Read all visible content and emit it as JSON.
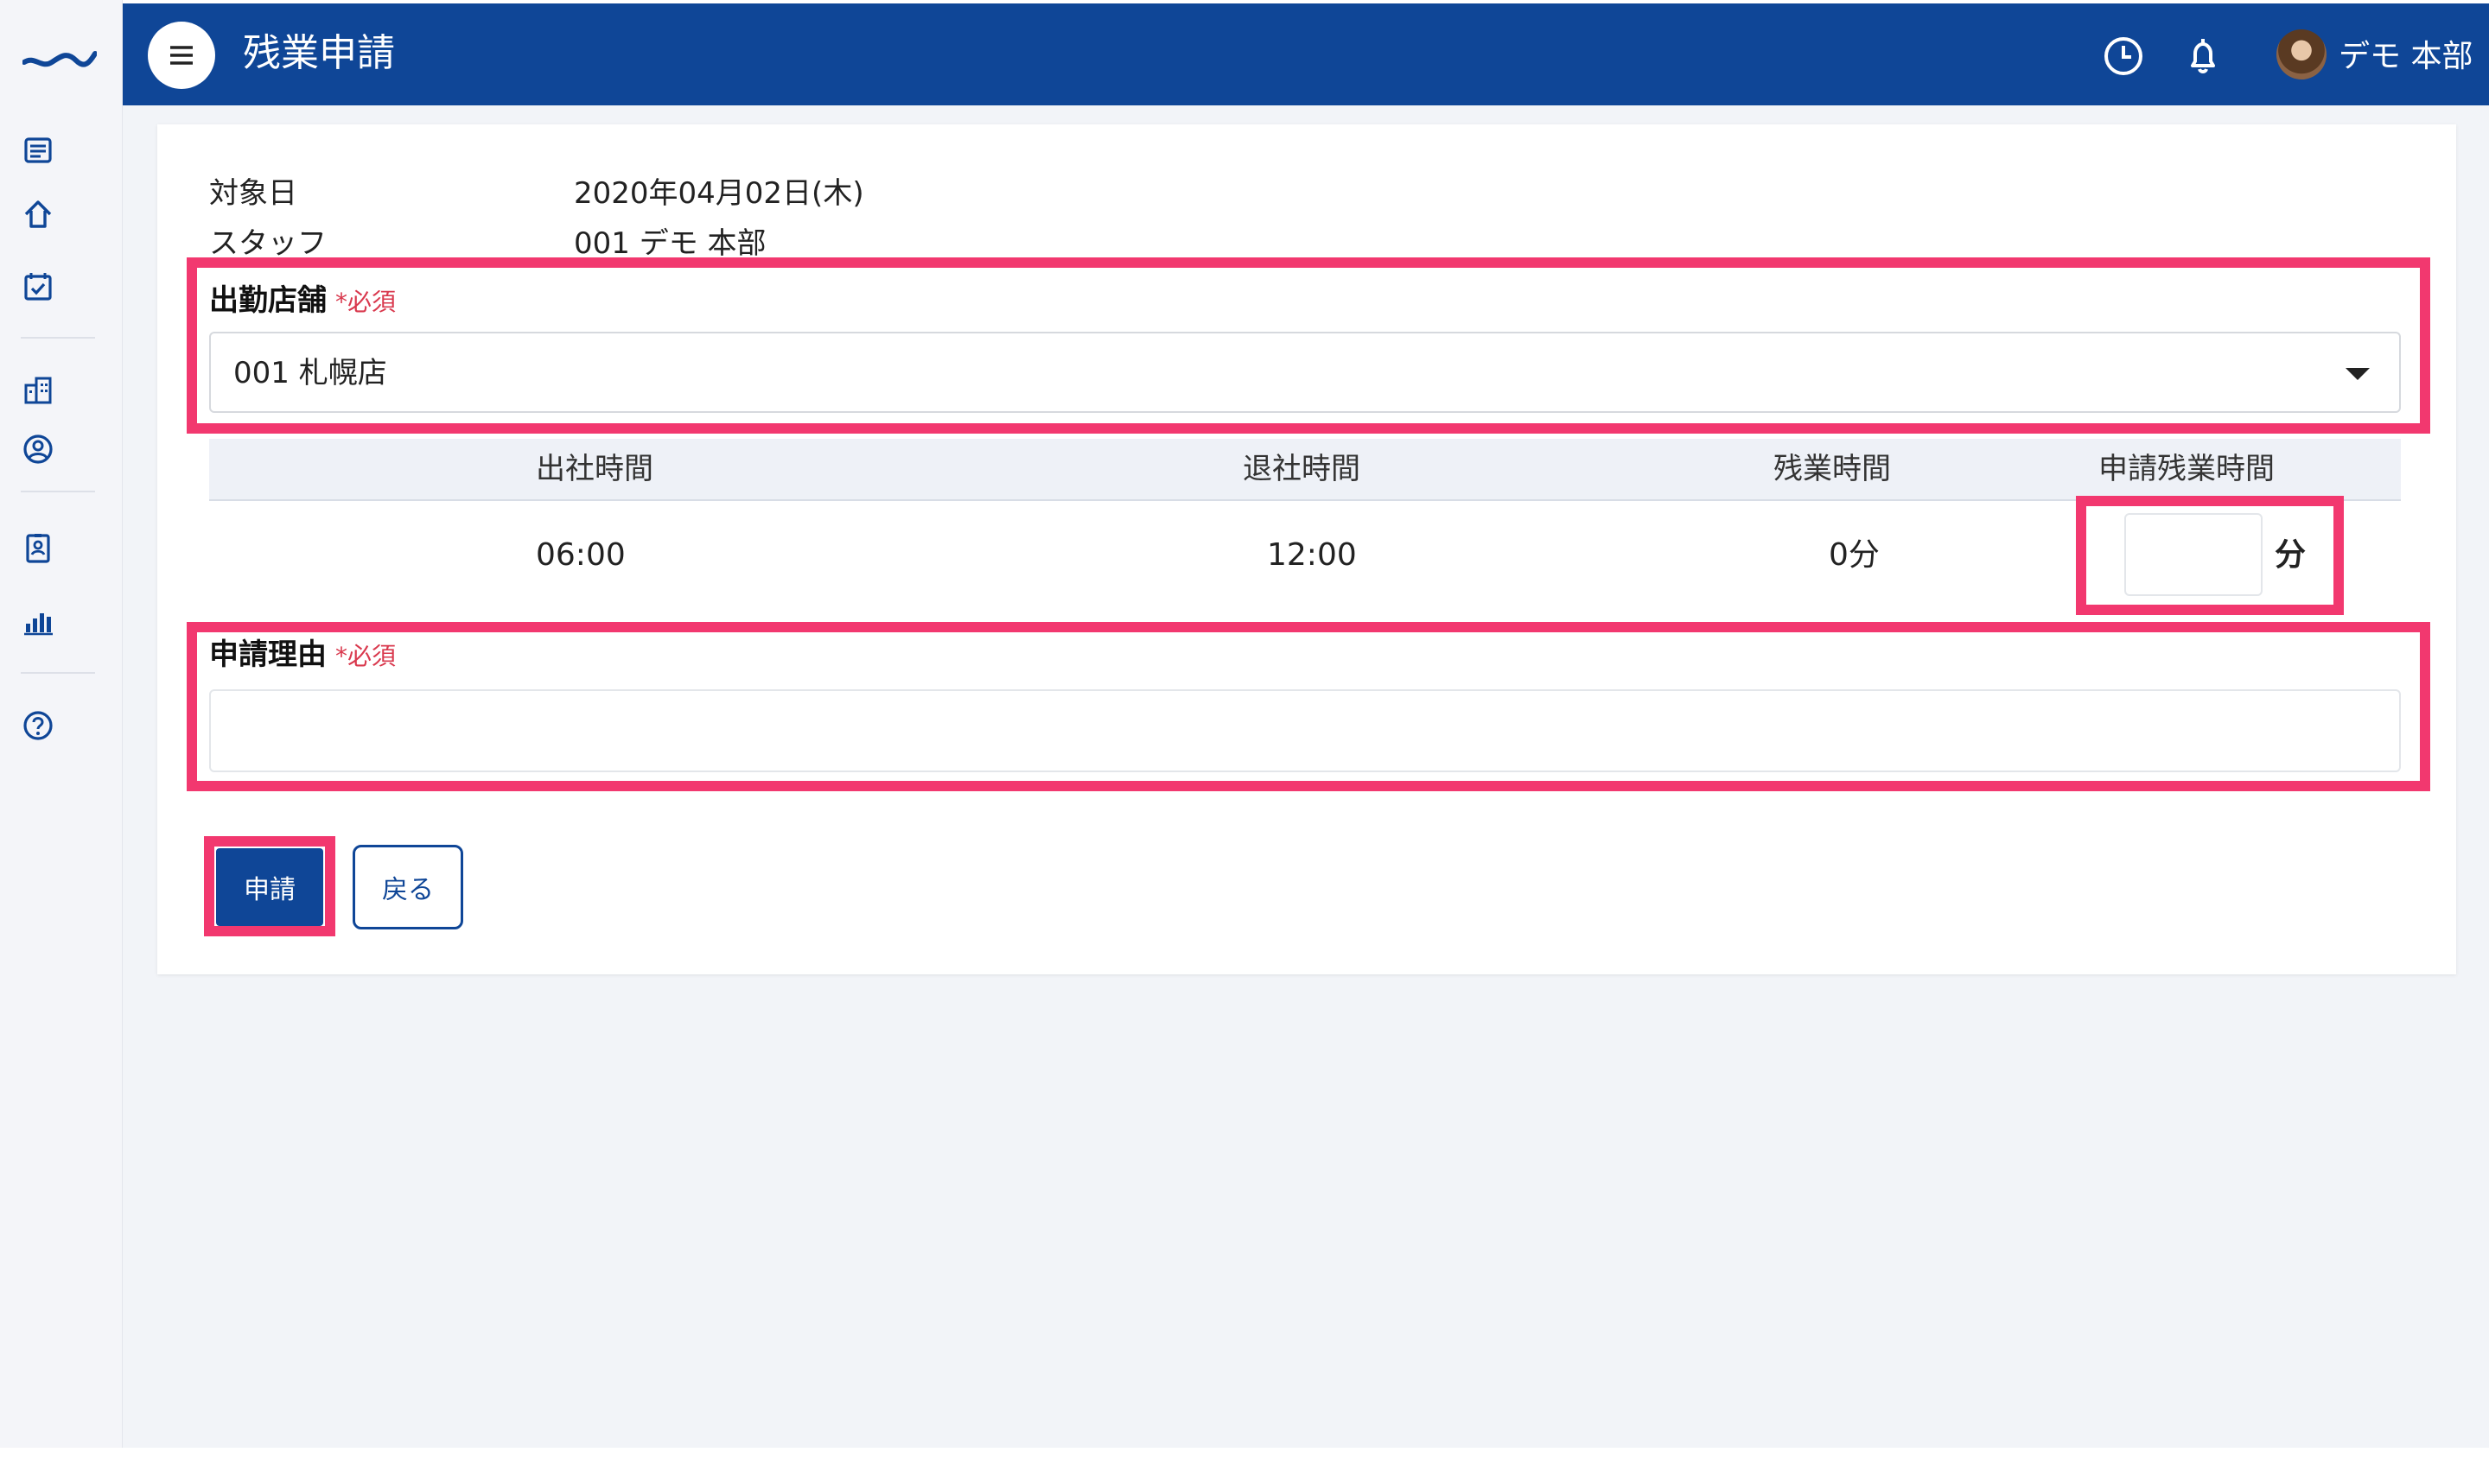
{
  "header": {
    "title": "残業申請",
    "user_name": "デモ 本部"
  },
  "sidebar": {
    "icons": [
      "list-icon",
      "home-icon",
      "calendar-check-icon",
      "building-icon",
      "user-circle-icon",
      "id-badge-icon",
      "bar-chart-icon",
      "help-icon"
    ]
  },
  "info": {
    "date_label": "対象日",
    "date_value": "2020年04月02日(木)",
    "staff_label": "スタッフ",
    "staff_value": "001 デモ 本部"
  },
  "store": {
    "label": "出勤店舗",
    "required": "*必須",
    "selected": "001 札幌店"
  },
  "table": {
    "headers": [
      "出社時間",
      "退社時間",
      "残業時間",
      "申請残業時間"
    ],
    "row": {
      "clock_in": "06:00",
      "clock_out": "12:00",
      "overtime": "0分",
      "request_input": "",
      "unit": "分"
    }
  },
  "reason": {
    "label": "申請理由",
    "required": "*必須",
    "value": ""
  },
  "actions": {
    "submit": "申請",
    "back": "戻る"
  },
  "colors": {
    "header_bg": "#0f4697",
    "highlight": "#f2386f",
    "required": "#d9384d"
  }
}
